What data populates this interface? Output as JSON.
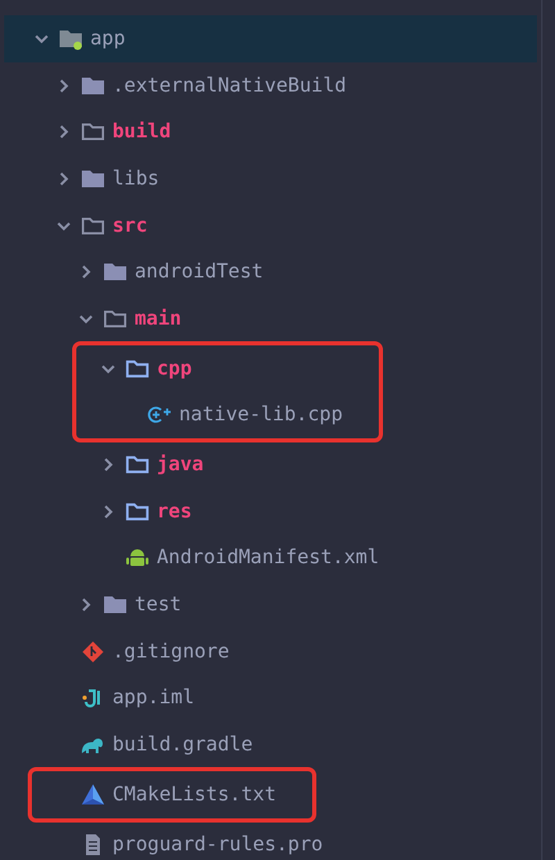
{
  "tree": [
    {
      "label": "app",
      "kind": "module",
      "expanded": true,
      "selected": true,
      "color": "#9aa0b8",
      "children": [
        {
          "label": ".externalNativeBuild",
          "kind": "folder",
          "expanded": false,
          "selected": false,
          "color": "#9aa0b8"
        },
        {
          "label": "build",
          "kind": "outline-folder",
          "expanded": false,
          "selected": false,
          "color": "#f0457c"
        },
        {
          "label": "libs",
          "kind": "folder",
          "expanded": false,
          "selected": false,
          "color": "#9aa0b8"
        },
        {
          "label": "src",
          "kind": "outline-folder",
          "expanded": true,
          "selected": false,
          "color": "#f0457c",
          "children": [
            {
              "label": "androidTest",
              "kind": "folder",
              "expanded": false,
              "selected": false,
              "color": "#9aa0b8"
            },
            {
              "label": "main",
              "kind": "outline-folder",
              "expanded": true,
              "selected": false,
              "color": "#f0457c",
              "children": [
                {
                  "label": "cpp",
                  "kind": "source-folder",
                  "expanded": true,
                  "selected": false,
                  "highlighted": true,
                  "color": "#f0457c",
                  "children": [
                    {
                      "label": "native-lib.cpp",
                      "kind": "cpp",
                      "selected": false,
                      "color": "#9aa0b8"
                    }
                  ]
                },
                {
                  "label": "java",
                  "kind": "source-folder",
                  "expanded": false,
                  "selected": false,
                  "color": "#f0457c"
                },
                {
                  "label": "res",
                  "kind": "source-folder",
                  "expanded": false,
                  "selected": false,
                  "color": "#f0457c"
                },
                {
                  "label": "AndroidManifest.xml",
                  "kind": "android",
                  "selected": false,
                  "color": "#9aa0b8"
                }
              ]
            },
            {
              "label": "test",
              "kind": "folder",
              "expanded": false,
              "selected": false,
              "color": "#9aa0b8"
            }
          ]
        },
        {
          "label": ".gitignore",
          "kind": "git",
          "selected": false,
          "color": "#9aa0b8"
        },
        {
          "label": "app.iml",
          "kind": "iml",
          "selected": false,
          "color": "#9aa0b8"
        },
        {
          "label": "build.gradle",
          "kind": "gradle",
          "selected": false,
          "color": "#9aa0b8"
        },
        {
          "label": "CMakeLists.txt",
          "kind": "cmake",
          "selected": false,
          "highlighted": true,
          "color": "#9aa0b8"
        },
        {
          "label": "proguard-rules.pro",
          "kind": "text",
          "selected": false,
          "color": "#9aa0b8"
        }
      ]
    }
  ]
}
